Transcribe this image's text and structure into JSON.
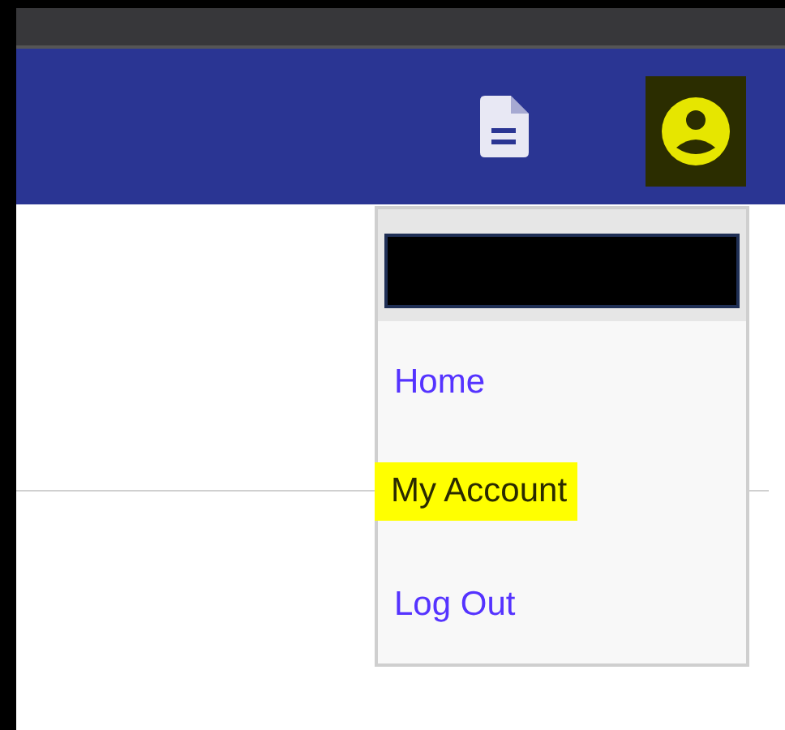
{
  "header": {
    "account_button": {
      "highlighted": true
    }
  },
  "menu": {
    "items": [
      {
        "label": "Home",
        "highlighted": false
      },
      {
        "label": "My Account",
        "highlighted": true
      },
      {
        "label": "Log Out",
        "highlighted": false
      }
    ]
  }
}
